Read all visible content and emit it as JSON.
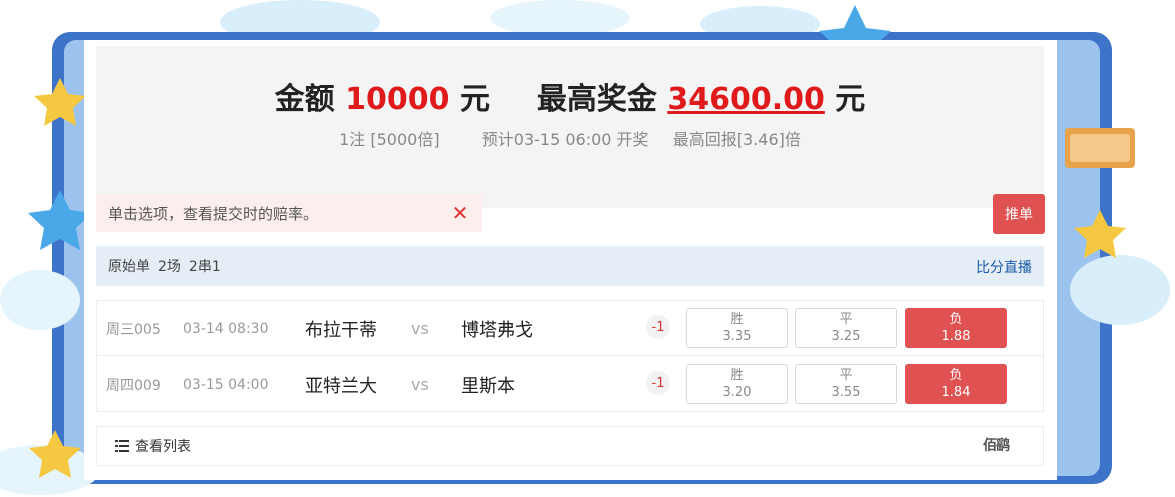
{
  "summary": {
    "amount_label": "金额",
    "amount_value": "10000",
    "amount_unit": "元",
    "max_prize_label": "最高奖金",
    "max_prize_value": "34600.00",
    "max_prize_unit": "元",
    "bet_count": "1注 [5000倍]",
    "expected_draw": "预计03-15 06:00 开奖",
    "max_return": "最高回报[3.46]倍"
  },
  "tip": {
    "text": "单击选项，查看提交时的赔率。",
    "close_symbol": "✕"
  },
  "push_button": "推单",
  "plan": {
    "type": "原始单",
    "matches": "2场",
    "combo": "2串1",
    "live_link": "比分直播"
  },
  "matches": [
    {
      "week_code": "周三005",
      "time": "03-14 08:30",
      "home": "布拉干蒂",
      "vs": "vs",
      "away": "博塔弗戈",
      "handicap": "-1",
      "win_label": "胜",
      "win_odds": "3.35",
      "draw_label": "平",
      "draw_odds": "3.25",
      "lose_label": "负",
      "lose_odds": "1.88",
      "selected": "lose"
    },
    {
      "week_code": "周四009",
      "time": "03-15 04:00",
      "home": "亚特兰大",
      "vs": "vs",
      "away": "里斯本",
      "handicap": "-1",
      "win_label": "胜",
      "win_odds": "3.20",
      "draw_label": "平",
      "draw_odds": "3.55",
      "lose_label": "负",
      "lose_odds": "1.84",
      "selected": "lose"
    }
  ],
  "footer": {
    "view_list": "查看列表",
    "stamp": "佰鹞"
  },
  "colors": {
    "accent_red": "#e0191b",
    "selected_odds": "#e05252",
    "plan_bar_bg": "#e5edf6",
    "link_blue": "#1a5aa8"
  },
  "icons": {
    "close": "close-icon",
    "list": "list-icon"
  }
}
